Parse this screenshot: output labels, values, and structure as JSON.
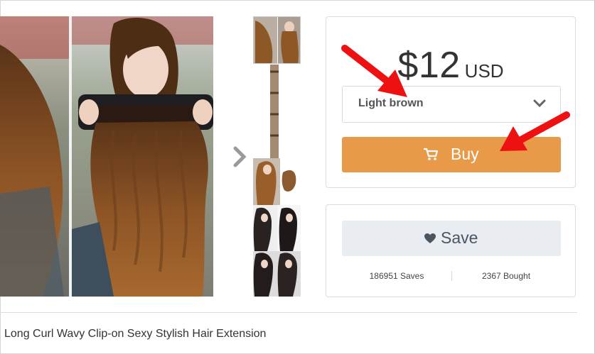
{
  "product": {
    "title": "Long Curl Wavy Clip-on Sexy Stylish Hair Extension"
  },
  "pricing": {
    "amount": "$12",
    "currency": "USD"
  },
  "variant_select": {
    "selected": "Light brown"
  },
  "actions": {
    "buy_label": "Buy",
    "save_label": "Save"
  },
  "stats": {
    "saves": "186951 Saves",
    "bought": "2367 Bought"
  },
  "colors": {
    "buy_button": "#e99a49",
    "save_button": "#e9edf1",
    "annotation_arrow": "#ee1111"
  },
  "icons": {
    "next": "chevron-right-icon",
    "dropdown": "chevron-down-icon",
    "cart": "cart-icon",
    "heart": "heart-icon"
  }
}
